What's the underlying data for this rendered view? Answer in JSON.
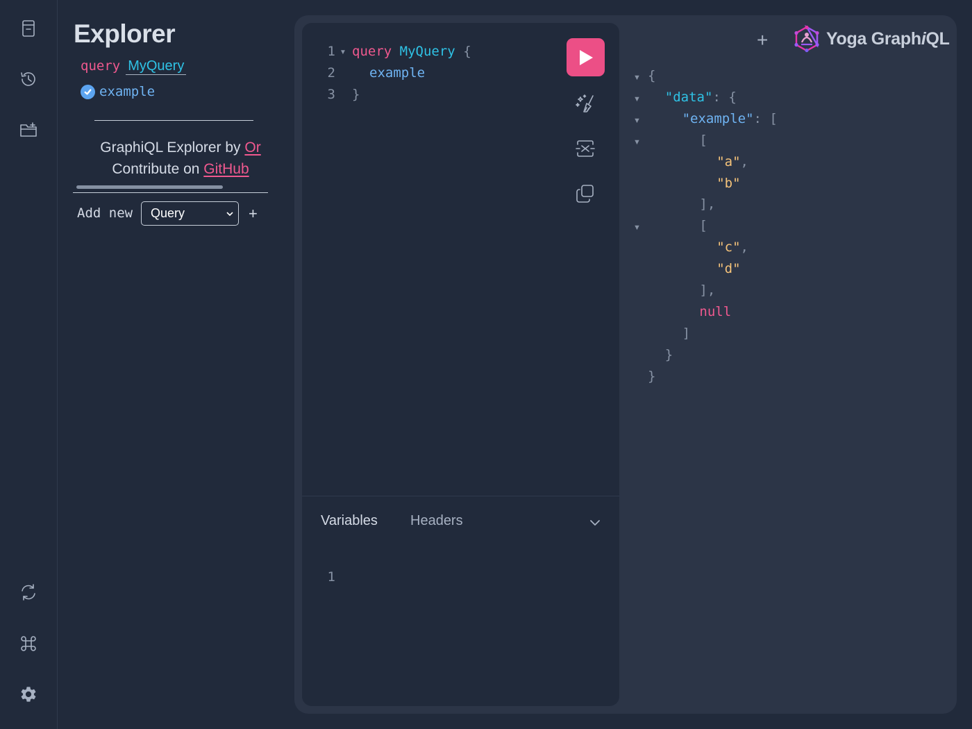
{
  "sidebar": {
    "icons": [
      "documentation-icon",
      "history-icon",
      "explorer-folder-icon",
      "refetch-schema-icon",
      "shortcuts-icon",
      "settings-icon"
    ]
  },
  "explorer": {
    "title": "Explorer",
    "operation_keyword": "query",
    "operation_name": "MyQuery",
    "field": "example",
    "field_checked": true,
    "credits_line1_prefix": "GraphiQL Explorer by ",
    "credits_line1_link": "Or",
    "credits_line2_prefix": "Contribute on ",
    "credits_line2_link": "GitHub",
    "add_new_label": "Add new",
    "add_new_selected": "Query",
    "add_new_plus": "+"
  },
  "editor": {
    "line_numbers": [
      "1",
      "2",
      "3"
    ],
    "code": {
      "keyword": "query",
      "name": "MyQuery",
      "open_brace": "{",
      "field": "example",
      "close_brace": "}"
    },
    "run_button": "run-query",
    "toolbar": [
      "prettify-icon",
      "merge-fragments-icon",
      "copy-icon"
    ]
  },
  "variables": {
    "tabs": [
      "Variables",
      "Headers"
    ],
    "active_tab": "Variables",
    "line_numbers": [
      "1"
    ]
  },
  "result": {
    "add_tab": "+",
    "logo_text_prefix": "Yoga Graph",
    "logo_text_italic": "i",
    "logo_text_suffix": "QL",
    "json_lines": [
      {
        "indent": 0,
        "fold": true,
        "parts": [
          [
            "p",
            "{"
          ]
        ]
      },
      {
        "indent": 1,
        "fold": true,
        "parts": [
          [
            "key",
            "\"data\""
          ],
          [
            "p",
            ": {"
          ]
        ]
      },
      {
        "indent": 2,
        "fold": true,
        "parts": [
          [
            "key2",
            "\"example\""
          ],
          [
            "p",
            ": ["
          ]
        ]
      },
      {
        "indent": 3,
        "fold": true,
        "parts": [
          [
            "p",
            "["
          ]
        ]
      },
      {
        "indent": 4,
        "fold": false,
        "parts": [
          [
            "str",
            "\"a\""
          ],
          [
            "p",
            ","
          ]
        ]
      },
      {
        "indent": 4,
        "fold": false,
        "parts": [
          [
            "str",
            "\"b\""
          ]
        ]
      },
      {
        "indent": 3,
        "fold": false,
        "parts": [
          [
            "p",
            "],"
          ]
        ]
      },
      {
        "indent": 3,
        "fold": true,
        "parts": [
          [
            "p",
            "["
          ]
        ]
      },
      {
        "indent": 4,
        "fold": false,
        "parts": [
          [
            "str",
            "\"c\""
          ],
          [
            "p",
            ","
          ]
        ]
      },
      {
        "indent": 4,
        "fold": false,
        "parts": [
          [
            "str",
            "\"d\""
          ]
        ]
      },
      {
        "indent": 3,
        "fold": false,
        "parts": [
          [
            "p",
            "],"
          ]
        ]
      },
      {
        "indent": 3,
        "fold": false,
        "parts": [
          [
            "null",
            "null"
          ]
        ]
      },
      {
        "indent": 2,
        "fold": false,
        "parts": [
          [
            "p",
            "]"
          ]
        ]
      },
      {
        "indent": 1,
        "fold": false,
        "parts": [
          [
            "p",
            "}"
          ]
        ]
      },
      {
        "indent": 0,
        "fold": false,
        "parts": [
          [
            "p",
            "}"
          ]
        ]
      }
    ]
  },
  "colors": {
    "background": "#212a3b",
    "panel": "#2c3547",
    "accent_pink": "#ec4f86",
    "cyan": "#2fc2e5",
    "string": "#f5c37a"
  }
}
